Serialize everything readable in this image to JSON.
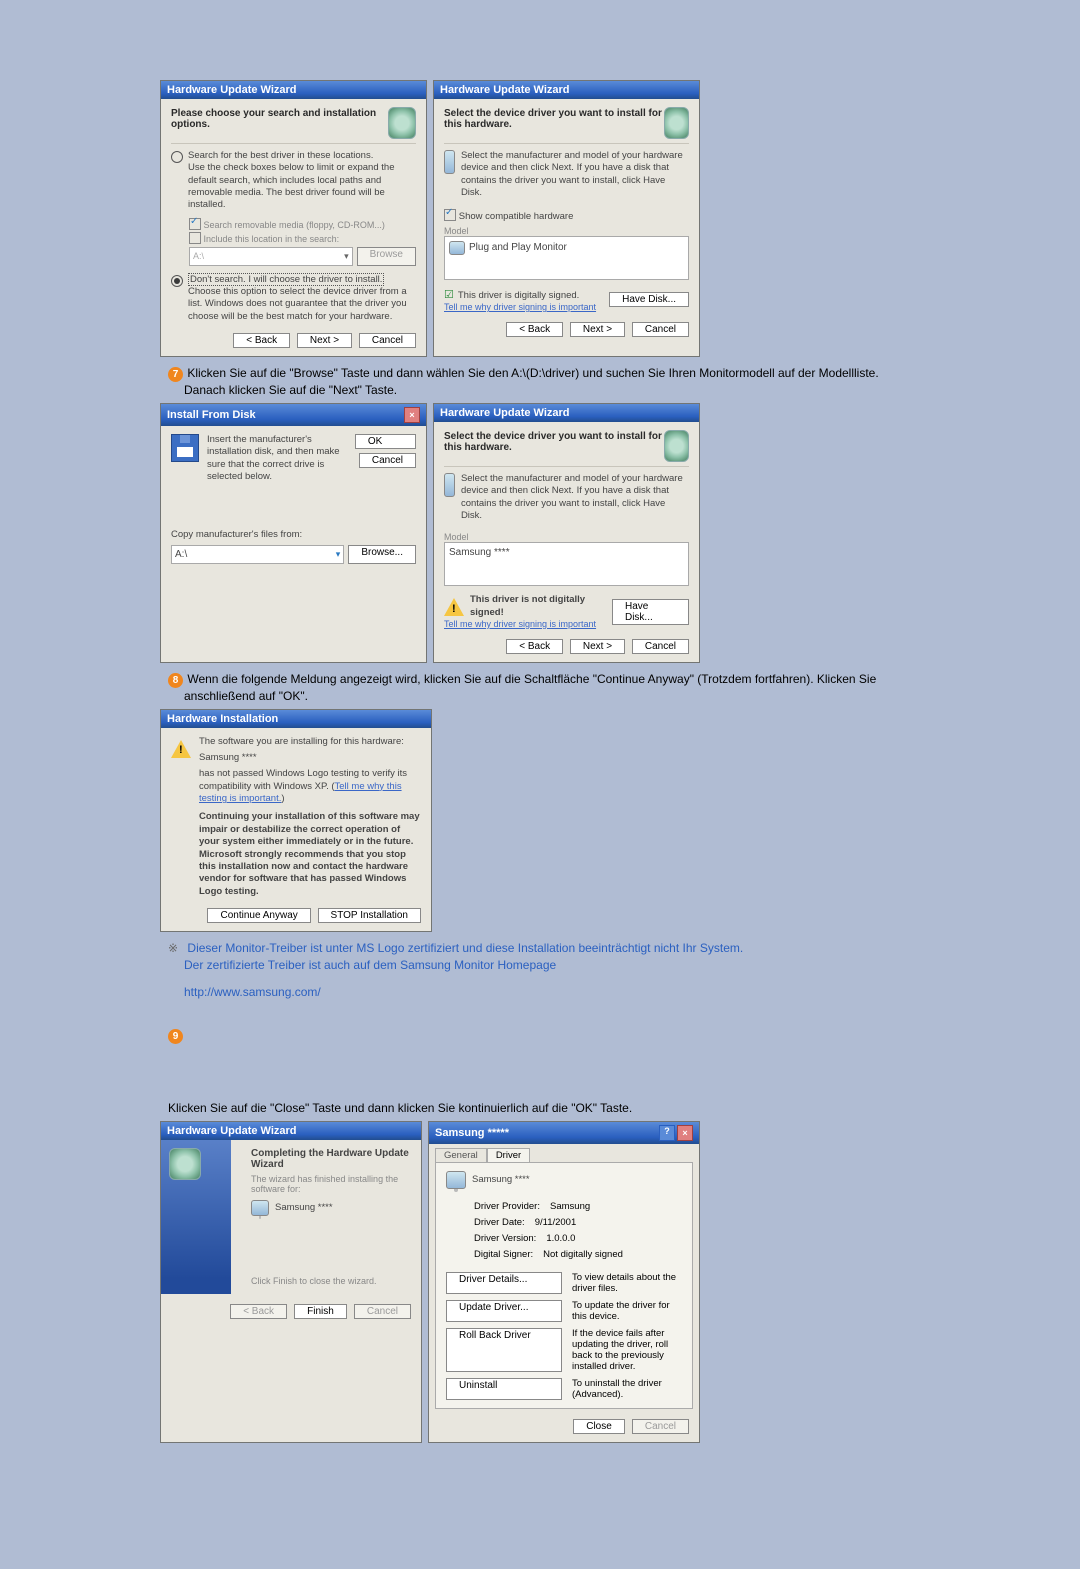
{
  "wiz1": {
    "title": "Hardware Update Wizard",
    "heading": "Please choose your search and installation options.",
    "opt1": "Search for the best driver in these locations.",
    "opt1_note": "Use the check boxes below to limit or expand the default search, which includes local paths and removable media. The best driver found will be installed.",
    "chk1": "Search removable media (floppy, CD-ROM...)",
    "chk2": "Include this location in the search:",
    "path": "A:\\",
    "browse": "Browse",
    "opt2": "Don't search. I will choose the driver to install.",
    "opt2_note": "Choose this option to select the device driver from a list. Windows does not guarantee that the driver you choose will be the best match for your hardware.",
    "back": "< Back",
    "next": "Next >",
    "cancel": "Cancel"
  },
  "wiz2": {
    "title": "Hardware Update Wizard",
    "heading": "Select the device driver you want to install for this hardware.",
    "note": "Select the manufacturer and model of your hardware device and then click Next. If you have a disk that contains the driver you want to install, click Have Disk.",
    "show": "Show compatible hardware",
    "model": "Model",
    "model_item": "Plug and Play Monitor",
    "signed": "This driver is digitally signed.",
    "tell": "Tell me why driver signing is important",
    "have": "Have Disk...",
    "back": "< Back",
    "next": "Next >",
    "cancel": "Cancel"
  },
  "step7": {
    "num": "7",
    "text": "Klicken Sie auf die \"Browse\" Taste und dann wählen Sie den A:\\(D:\\driver) und suchen Sie Ihren Monitormodell auf der Modellliste. Danach klicken Sie auf die \"Next\" Taste."
  },
  "install_disk": {
    "title": "Install From Disk",
    "msg": "Insert the manufacturer's installation disk, and then make sure that the correct drive is selected below.",
    "ok": "OK",
    "cancel": "Cancel",
    "copy": "Copy manufacturer's files from:",
    "path": "A:\\",
    "browse": "Browse..."
  },
  "wiz3": {
    "title": "Hardware Update Wizard",
    "heading": "Select the device driver you want to install for this hardware.",
    "note": "Select the manufacturer and model of your hardware device and then click Next. If you have a disk that contains the driver you want to install, click Have Disk.",
    "model": "Model",
    "model_item": "Samsung ****",
    "unsigned": "This driver is not digitally signed!",
    "tell": "Tell me why driver signing is important",
    "have": "Have Disk...",
    "back": "< Back",
    "next": "Next >",
    "cancel": "Cancel"
  },
  "step8": {
    "num": "8",
    "text": "Wenn die folgende Meldung angezeigt wird, klicken Sie auf die Schaltfläche \"Continue Anyway\" (Trotzdem fortfahren). Klicken Sie anschließend auf \"OK\"."
  },
  "hwinstall": {
    "title": "Hardware Installation",
    "line1": "The software you are installing for this hardware:",
    "line2": "Samsung ****",
    "line3a": "has not passed Windows Logo testing to verify its compatibility with Windows XP. (",
    "line3b": "Tell me why this testing is important.",
    "line3c": ")",
    "bold": "Continuing your installation of this software may impair or destabilize the correct operation of your system either immediately or in the future. Microsoft strongly recommends that you stop this installation now and contact the hardware vendor for software that has passed Windows Logo testing.",
    "cont": "Continue Anyway",
    "stop": "STOP Installation"
  },
  "note_cert": {
    "l1": "Dieser Monitor-Treiber ist unter MS Logo zertifiziert und diese Installation beeinträchtigt nicht Ihr System.",
    "l2": "Der zertifizierte Treiber ist auch auf dem Samsung Monitor Homepage",
    "url": "http://www.samsung.com/"
  },
  "step9": {
    "num": "9"
  },
  "step_close": "Klicken Sie auf die \"Close\" Taste und dann klicken Sie kontinuierlich auf die \"OK\" Taste.",
  "wiz_done": {
    "title": "Hardware Update Wizard",
    "head": "Completing the Hardware Update Wizard",
    "sub": "The wizard has finished installing the software for:",
    "dev": "Samsung ****",
    "click": "Click Finish to close the wizard.",
    "back": "< Back",
    "finish": "Finish",
    "cancel": "Cancel"
  },
  "props": {
    "title": "Samsung *****",
    "t1": "General",
    "t2": "Driver",
    "dev": "Samsung ****",
    "r1a": "Driver Provider:",
    "r1b": "Samsung",
    "r2a": "Driver Date:",
    "r2b": "9/11/2001",
    "r3a": "Driver Version:",
    "r3b": "1.0.0.0",
    "r4a": "Digital Signer:",
    "r4b": "Not digitally signed",
    "b1": "Driver Details...",
    "d1": "To view details about the driver files.",
    "b2": "Update Driver...",
    "d2": "To update the driver for this device.",
    "b3": "Roll Back Driver",
    "d3": "If the device fails after updating the driver, roll back to the previously installed driver.",
    "b4": "Uninstall",
    "d4": "To uninstall the driver (Advanced).",
    "close": "Close",
    "cancel": "Cancel"
  }
}
